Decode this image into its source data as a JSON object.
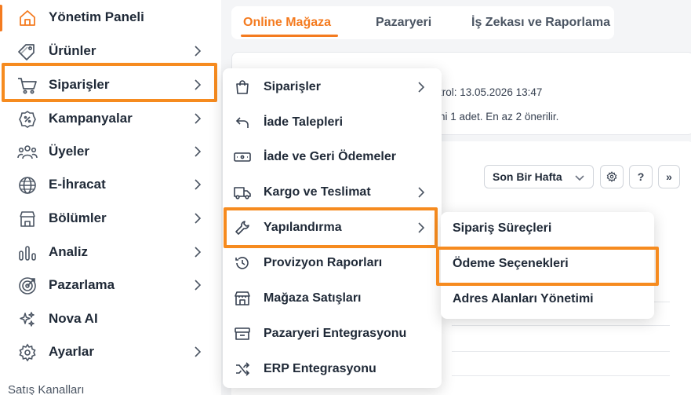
{
  "sidebar": {
    "items": [
      {
        "label": "Yönetim Paneli",
        "icon": "home-icon"
      },
      {
        "label": "Ürünler",
        "icon": "tag-icon"
      },
      {
        "label": "Siparişler",
        "icon": "cart-icon"
      },
      {
        "label": "Kampanyalar",
        "icon": "percent-badge-icon"
      },
      {
        "label": "Üyeler",
        "icon": "users-icon"
      },
      {
        "label": "E-İhracat",
        "icon": "globe-icon"
      },
      {
        "label": "Bölümler",
        "icon": "storefront-icon"
      },
      {
        "label": "Analiz",
        "icon": "analytics-icon"
      },
      {
        "label": "Pazarlama",
        "icon": "target-icon"
      },
      {
        "label": "Nova AI",
        "icon": "sparkles-icon"
      },
      {
        "label": "Ayarlar",
        "icon": "gear-icon"
      }
    ],
    "section_title": "Satış Kanalları"
  },
  "tabs": [
    {
      "label": "Online Mağaza"
    },
    {
      "label": "Pazaryeri"
    },
    {
      "label": "İş Zekası ve Raporlama"
    }
  ],
  "info": {
    "line1": "trol: 13.05.2026 13:47",
    "line2": "ni 1 adet. En az 2 önerilir."
  },
  "filters": {
    "period": "Son Bir Hafta",
    "help_label": "?",
    "expand_label": "»"
  },
  "orders_menu": {
    "items": [
      {
        "label": "Siparişler",
        "icon": "shopping-bag-icon"
      },
      {
        "label": "İade Talepleri",
        "icon": "undo-arrow-icon"
      },
      {
        "label": "İade ve Geri Ödemeler",
        "icon": "cash-icon"
      },
      {
        "label": "Kargo ve Teslimat",
        "icon": "truck-icon"
      },
      {
        "label": "Yapılandırma",
        "icon": "wrench-icon"
      },
      {
        "label": "Provizyon Raporları",
        "icon": "history-icon"
      },
      {
        "label": "Mağaza Satışları",
        "icon": "store-icon"
      },
      {
        "label": "Pazaryeri Entegrasyonu",
        "icon": "archive-box-icon"
      },
      {
        "label": "ERP Entegrasyonu",
        "icon": "shuffle-icon"
      }
    ]
  },
  "config_submenu": {
    "items": [
      {
        "label": "Sipariş Süreçleri"
      },
      {
        "label": "Ödeme Seçenekleri"
      },
      {
        "label": "Adres Alanları Yönetimi"
      }
    ]
  },
  "colors": {
    "accent": "#f47b20",
    "highlight": "#f68b1f"
  }
}
